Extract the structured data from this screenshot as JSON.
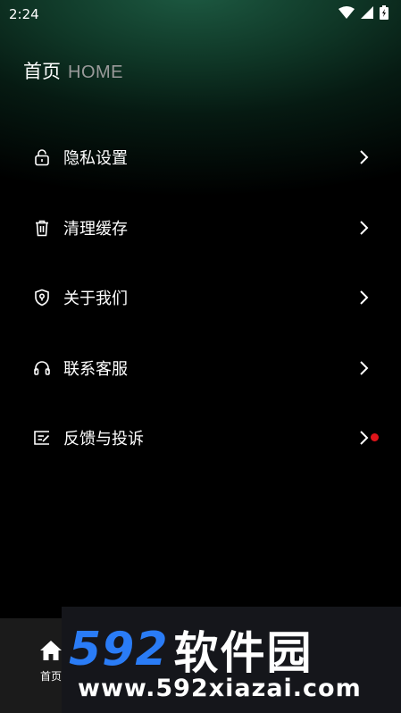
{
  "status_bar": {
    "time": "2:24",
    "icons": [
      "wifi-icon",
      "signal-icon",
      "battery-icon"
    ]
  },
  "header": {
    "title": "首页",
    "subtitle": "HOME"
  },
  "menu": {
    "items": [
      {
        "label": "隐私设置",
        "icon": "lock-icon"
      },
      {
        "label": "清理缓存",
        "icon": "trash-icon"
      },
      {
        "label": "关于我们",
        "icon": "shield-icon"
      },
      {
        "label": "联系客服",
        "icon": "headset-icon"
      },
      {
        "label": "反馈与投诉",
        "icon": "feedback-icon",
        "badge": true
      }
    ],
    "badge_color": "#e0141a"
  },
  "tabbar": {
    "home_label": "首页",
    "home_icon": "home-icon"
  },
  "watermark": {
    "number": "592",
    "name": "软件园",
    "url": "www.592xiazai.com",
    "accent": "#2a7cf6"
  },
  "colors": {
    "background": "#000000",
    "header_gradient": "#1d5a42",
    "text": "#ffffff",
    "subtitle": "#9a9a9a"
  }
}
